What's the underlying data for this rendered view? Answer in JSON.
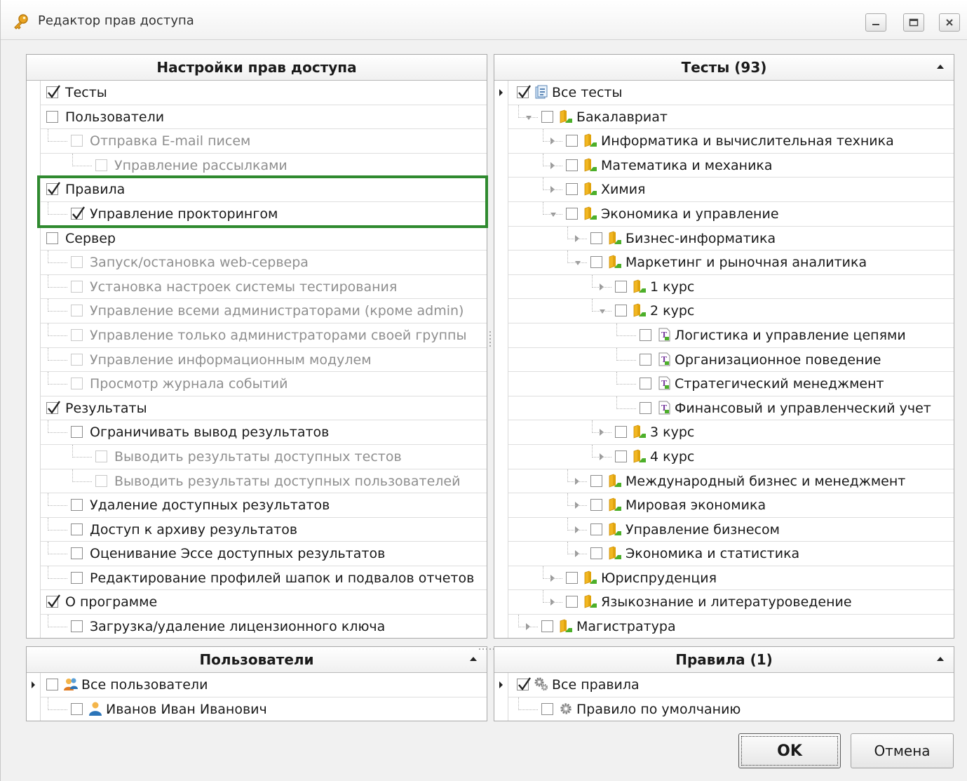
{
  "window": {
    "title": "Редактор прав доступа",
    "controls": {
      "minimize": "minimize",
      "maximize": "maximize",
      "close": "close"
    }
  },
  "permissions": {
    "header": "Настройки прав доступа",
    "items": [
      {
        "label": "Тесты",
        "level": 0,
        "checked": true,
        "disabled": false
      },
      {
        "label": "Пользователи",
        "level": 0,
        "checked": false,
        "disabled": false
      },
      {
        "label": "Отправка E-mail писем",
        "level": 1,
        "checked": false,
        "disabled": true
      },
      {
        "label": "Управление рассылками",
        "level": 2,
        "checked": false,
        "disabled": true
      },
      {
        "label": "Правила",
        "level": 0,
        "checked": true,
        "disabled": false
      },
      {
        "label": "Управление прокторингом",
        "level": 1,
        "checked": true,
        "disabled": false
      },
      {
        "label": "Сервер",
        "level": 0,
        "checked": false,
        "disabled": false
      },
      {
        "label": "Запуск/остановка web-сервера",
        "level": 1,
        "checked": false,
        "disabled": true
      },
      {
        "label": "Установка настроек системы тестирования",
        "level": 1,
        "checked": false,
        "disabled": true
      },
      {
        "label": "Управление всеми администраторами (кроме admin)",
        "level": 1,
        "checked": false,
        "disabled": true
      },
      {
        "label": "Управление только администраторами своей группы",
        "level": 1,
        "checked": false,
        "disabled": true
      },
      {
        "label": "Управление информационным модулем",
        "level": 1,
        "checked": false,
        "disabled": true
      },
      {
        "label": "Просмотр журнала событий",
        "level": 1,
        "checked": false,
        "disabled": true
      },
      {
        "label": "Результаты",
        "level": 0,
        "checked": true,
        "disabled": false
      },
      {
        "label": "Ограничивать вывод результатов",
        "level": 1,
        "checked": false,
        "disabled": false
      },
      {
        "label": "Выводить результаты доступных тестов",
        "level": 2,
        "checked": false,
        "disabled": true
      },
      {
        "label": "Выводить результаты доступных пользователей",
        "level": 2,
        "checked": false,
        "disabled": true
      },
      {
        "label": "Удаление доступных результатов",
        "level": 1,
        "checked": false,
        "disabled": false
      },
      {
        "label": "Доступ к архиву результатов",
        "level": 1,
        "checked": false,
        "disabled": false
      },
      {
        "label": "Оценивание Эссе доступных результатов",
        "level": 1,
        "checked": false,
        "disabled": false
      },
      {
        "label": "Редактирование профилей шапок и подвалов отчетов",
        "level": 1,
        "checked": false,
        "disabled": false
      },
      {
        "label": "О программе",
        "level": 0,
        "checked": true,
        "disabled": false
      },
      {
        "label": "Загрузка/удаление лицензионного ключа",
        "level": 1,
        "checked": false,
        "disabled": false
      }
    ]
  },
  "tests": {
    "header": "Тесты (93)",
    "items": [
      {
        "label": "Все тесты",
        "level": 0,
        "checked": true,
        "icon": "tests-root-icon",
        "expander": "collapsed-dark"
      },
      {
        "label": "Бакалавриат",
        "level": 1,
        "checked": false,
        "icon": "folder-icon",
        "expander": "open"
      },
      {
        "label": "Информатика и вычислительная техника",
        "level": 2,
        "checked": false,
        "icon": "folder-icon",
        "expander": "collapsed"
      },
      {
        "label": "Математика и механика",
        "level": 2,
        "checked": false,
        "icon": "folder-icon",
        "expander": "collapsed"
      },
      {
        "label": "Химия",
        "level": 2,
        "checked": false,
        "icon": "folder-icon",
        "expander": "collapsed"
      },
      {
        "label": "Экономика и управление",
        "level": 2,
        "checked": false,
        "icon": "folder-icon",
        "expander": "open"
      },
      {
        "label": "Бизнес-информатика",
        "level": 3,
        "checked": false,
        "icon": "folder-icon",
        "expander": "collapsed"
      },
      {
        "label": "Маркетинг и рыночная аналитика",
        "level": 3,
        "checked": false,
        "icon": "folder-icon",
        "expander": "open"
      },
      {
        "label": "1 курс",
        "level": 4,
        "checked": false,
        "icon": "folder-icon",
        "expander": "collapsed"
      },
      {
        "label": "2 курс",
        "level": 4,
        "checked": false,
        "icon": "folder-icon",
        "expander": "open"
      },
      {
        "label": "Логистика и управление цепями",
        "level": 5,
        "checked": false,
        "icon": "test-icon",
        "expander": "none"
      },
      {
        "label": "Организационное поведение",
        "level": 5,
        "checked": false,
        "icon": "test-icon",
        "expander": "none"
      },
      {
        "label": "Стратегический менеджмент",
        "level": 5,
        "checked": false,
        "icon": "test-icon",
        "expander": "none"
      },
      {
        "label": "Финансовый и управленческий учет",
        "level": 5,
        "checked": false,
        "icon": "test-icon",
        "expander": "none"
      },
      {
        "label": "3 курс",
        "level": 4,
        "checked": false,
        "icon": "folder-icon",
        "expander": "collapsed"
      },
      {
        "label": "4 курс",
        "level": 4,
        "checked": false,
        "icon": "folder-icon",
        "expander": "collapsed"
      },
      {
        "label": "Международный бизнес и менеджмент",
        "level": 3,
        "checked": false,
        "icon": "folder-icon",
        "expander": "collapsed"
      },
      {
        "label": "Мировая экономика",
        "level": 3,
        "checked": false,
        "icon": "folder-icon",
        "expander": "collapsed"
      },
      {
        "label": "Управление бизнесом",
        "level": 3,
        "checked": false,
        "icon": "folder-icon",
        "expander": "collapsed"
      },
      {
        "label": "Экономика и статистика",
        "level": 3,
        "checked": false,
        "icon": "folder-icon",
        "expander": "collapsed"
      },
      {
        "label": "Юриспруденция",
        "level": 2,
        "checked": false,
        "icon": "folder-icon",
        "expander": "collapsed"
      },
      {
        "label": "Языкознание и литературоведение",
        "level": 2,
        "checked": false,
        "icon": "folder-icon",
        "expander": "collapsed"
      },
      {
        "label": "Магистратура",
        "level": 1,
        "checked": false,
        "icon": "folder-icon",
        "expander": "collapsed"
      }
    ]
  },
  "users": {
    "header": "Пользователи",
    "items": [
      {
        "label": "Все пользователи",
        "level": 0,
        "checked": false,
        "icon": "users-group-icon",
        "expander": "collapsed-dark"
      },
      {
        "label": "Иванов Иван Иванович",
        "level": 1,
        "checked": false,
        "icon": "user-icon",
        "expander": "none"
      }
    ]
  },
  "rules": {
    "header": "Правила (1)",
    "items": [
      {
        "label": "Все правила",
        "level": 0,
        "checked": true,
        "icon": "gears-icon",
        "expander": "collapsed-dark"
      },
      {
        "label": "Правило по умолчанию",
        "level": 1,
        "checked": false,
        "icon": "gear-icon",
        "expander": "none"
      }
    ]
  },
  "buttons": {
    "ok": "OK",
    "cancel": "Отмена"
  },
  "colors": {
    "highlight": "#2f8a2f",
    "folder": "#f2b721",
    "folder_accent": "#4caf2a"
  }
}
